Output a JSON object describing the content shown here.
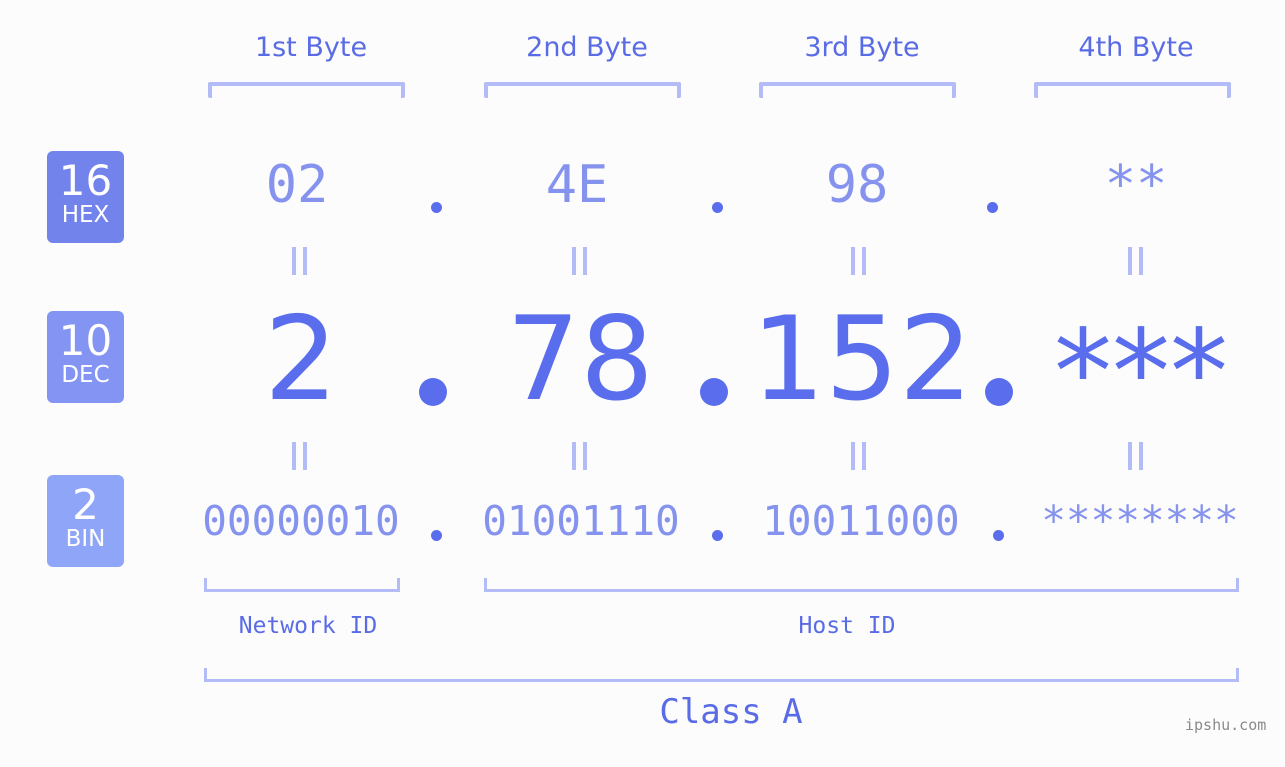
{
  "bytes": {
    "headers": [
      "1st Byte",
      "2nd Byte",
      "3rd Byte",
      "4th Byte"
    ]
  },
  "badges": {
    "hex": {
      "base": "16",
      "label": "HEX",
      "color": "#7383ec"
    },
    "dec": {
      "base": "10",
      "label": "DEC",
      "color": "#8494f2"
    },
    "bin": {
      "base": "2",
      "label": "BIN",
      "color": "#8fa6f8"
    }
  },
  "hex": [
    "02",
    "4E",
    "98",
    "**"
  ],
  "dec": [
    "2",
    "78",
    "152",
    "***"
  ],
  "bin": [
    "00000010",
    "01001110",
    "10011000",
    "********"
  ],
  "sections": {
    "network": "Network ID",
    "host": "Host ID",
    "class": "Class A"
  },
  "watermark": "ipshu.com",
  "colors": {
    "accent": "#5a6ded",
    "light": "#8593ee",
    "bracket": "#b3bcf6",
    "background": "#fbfcfb"
  }
}
